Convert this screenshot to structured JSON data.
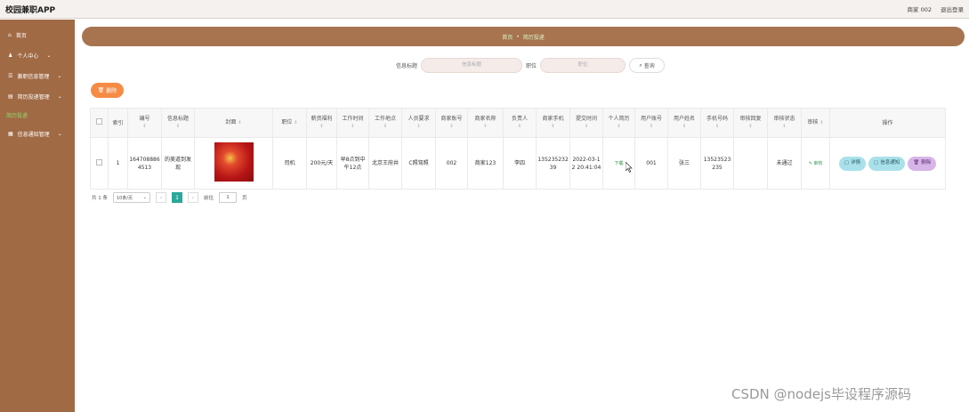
{
  "app": {
    "title": "校园兼职APP"
  },
  "header": {
    "user": "商家 002",
    "logout": "退出登录"
  },
  "sidebar": {
    "items": [
      {
        "label": "首页",
        "icon": "home-icon",
        "chevron": false
      },
      {
        "label": "个人中心",
        "icon": "user-icon",
        "chevron": true
      },
      {
        "label": "兼职信息管理",
        "icon": "list-icon",
        "chevron": true
      },
      {
        "label": "简历投递管理",
        "icon": "doc-icon",
        "chevron": true
      },
      {
        "label": "简历投递",
        "icon": "",
        "chevron": false,
        "active": true
      },
      {
        "label": "信息通知管理",
        "icon": "grid-icon",
        "chevron": true
      }
    ]
  },
  "breadcrumb": {
    "home": "首页",
    "sep": "•",
    "current": "简历投递"
  },
  "search": {
    "title_label": "信息标题",
    "title_placeholder": "信息标题",
    "job_label": "职位",
    "job_placeholder": "职位",
    "query_button": "查询"
  },
  "toolbar": {
    "delete_label": "删除"
  },
  "table": {
    "columns": [
      "索引",
      "编号",
      "信息标题",
      "封面",
      "职位",
      "薪资福利",
      "工作时间",
      "工作地点",
      "人员要求",
      "商家账号",
      "商家名称",
      "负责人",
      "商家手机",
      "提交时间",
      "个人简历",
      "用户账号",
      "用户姓名",
      "手机号码",
      "审核回复",
      "审核状态",
      "审核",
      "操作"
    ],
    "rows": [
      {
        "index": "1",
        "number": "1647088864513",
        "info_title": "的美道到发现",
        "position": "司机",
        "salary": "200元/天",
        "work_time": "早8点到中午12点",
        "location": "北京王府井",
        "requirement": "C照驾照",
        "merchant_account": "002",
        "merchant_name": "商家123",
        "manager": "李四",
        "merchant_phone": "13523523239",
        "submit_time": "2022-03-12 20:41:04",
        "resume": "下载",
        "user_account": "001",
        "user_name": "张三",
        "phone": "13523523235",
        "review_reply": "",
        "review_status": "未通过",
        "review": "审核",
        "actions": {
          "detail": "详情",
          "notify": "信息通知",
          "delete": "删除"
        }
      }
    ]
  },
  "pager": {
    "total": "共 1 条",
    "page_size": "10条/页",
    "current_page": "1",
    "goto_label": "前往",
    "goto_value": "1",
    "page_unit": "页"
  },
  "watermark": "CSDN @nodejs毕设程序源码"
}
